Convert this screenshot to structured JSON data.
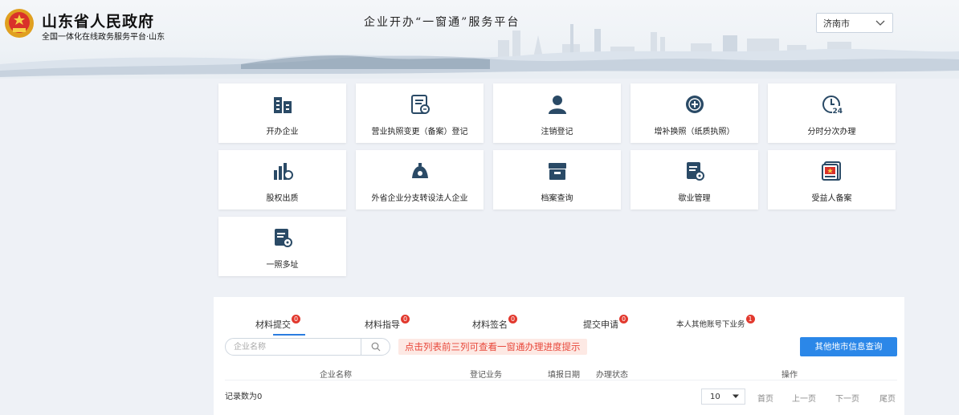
{
  "header": {
    "gov_title": "山东省人民政府",
    "gov_subtitle": "全国一体化在线政务服务平台·山东",
    "platform_title": "企业开办“一窗通”服务平台",
    "city_select": "济南市"
  },
  "services": [
    {
      "label": "开办企业",
      "icon": "company-building-icon"
    },
    {
      "label": "营业执照变更（备案）登记",
      "icon": "document-refresh-icon"
    },
    {
      "label": "注销登记",
      "icon": "user-icon"
    },
    {
      "label": "增补换照（纸质执照）",
      "icon": "plus-circle-icon"
    },
    {
      "label": "分时分次办理",
      "icon": "clock-24-icon"
    },
    {
      "label": "股权出质",
      "icon": "equity-chart-icon"
    },
    {
      "label": "外省企业分支转设法人企业",
      "icon": "bell-branch-icon"
    },
    {
      "label": "档案查询",
      "icon": "archive-box-icon"
    },
    {
      "label": "歇业管理",
      "icon": "document-gear-icon"
    },
    {
      "label": "受益人备案",
      "icon": "beneficiary-record-icon"
    },
    {
      "label": "一照多址",
      "icon": "document-gear-icon"
    }
  ],
  "tabs": [
    {
      "label": "材料提交",
      "badge": "0"
    },
    {
      "label": "材料指导",
      "badge": "0"
    },
    {
      "label": "材料签名",
      "badge": "0"
    },
    {
      "label": "提交申请",
      "badge": "0"
    },
    {
      "label": "本人其他账号下业务",
      "badge": "1"
    }
  ],
  "search": {
    "placeholder": "企业名称"
  },
  "hint": "点击列表前三列可查看一窗通办理进度提示",
  "other_region_button": "其他地市信息查询",
  "table": {
    "columns": [
      "企业名称",
      "登记业务",
      "填报日期",
      "办理状态",
      "操作"
    ]
  },
  "record_count": "记录数为0",
  "pagination": {
    "page_size": "10",
    "first": "首页",
    "prev": "上一页",
    "next": "下一页",
    "last": "尾页"
  },
  "colors": {
    "accent": "#2b87e8",
    "badge": "#e2392e",
    "icon": "#2a4a66",
    "hint_bg": "#fde9e4",
    "hint_text": "#e8473a"
  }
}
